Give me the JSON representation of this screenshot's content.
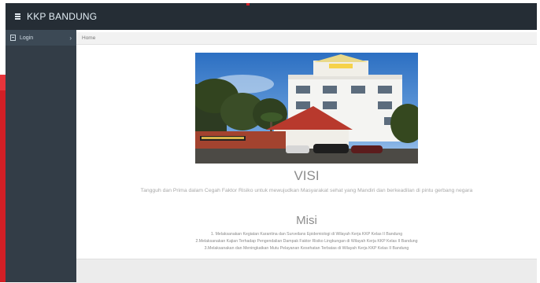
{
  "app": {
    "brand": "KKP BANDUNG"
  },
  "sidebar": {
    "items": [
      {
        "label": "Login",
        "chevron": "›"
      }
    ]
  },
  "breadcrumb": {
    "current": "Home"
  },
  "visi": {
    "title": "VISI",
    "text": "Tangguh dan Prima dalam Cegah Faktor Risiko untuk mewujudkan Masyarakat sehat yang Mandiri dan berkeadilan di pintu gerbang negara"
  },
  "misi": {
    "title": "Misi",
    "items": [
      "1. Melaksanakan Kegiatan Karantina dan Surveilans Epidemiologi di Wilayah Kerja KKP Kelas II Bandung",
      "2.Melaksanakan Kajian Terhadap Pengendalian Dampak Faktor Risiko Lingkungan di Wilayah Kerja KKP Kelas II Bandung",
      "3.Melaksanakan dan Meningkatkan Mutu Pelayanan Kesehatan Terbatas di Wilayah Kerja KKP Kelas II Bandung"
    ]
  },
  "colors": {
    "topbar": "#252d35",
    "sidebar": "#333d47",
    "accent": "#d21f26",
    "content_bg": "#ffffff"
  }
}
